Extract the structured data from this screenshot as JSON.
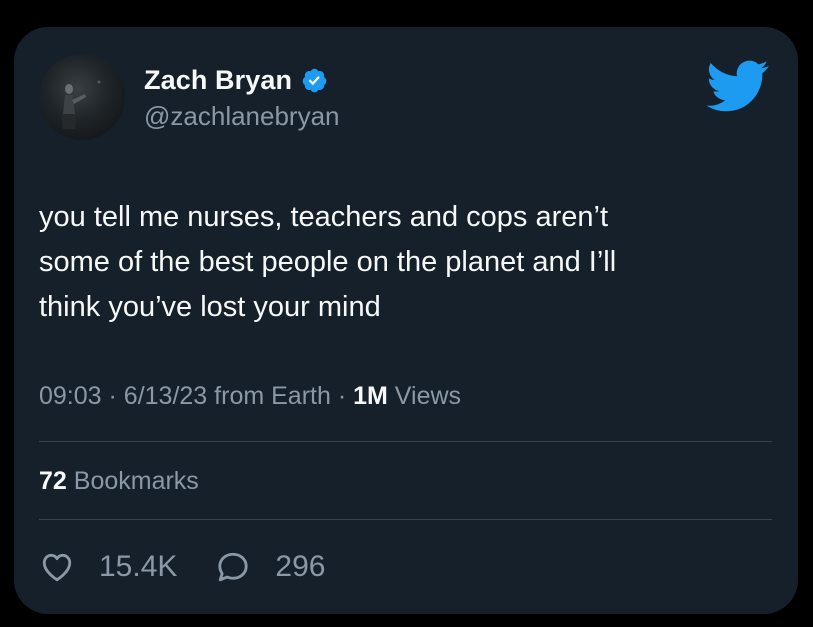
{
  "user": {
    "name": "Zach Bryan",
    "handle": "@zachlanebryan"
  },
  "icons": {
    "avatar": "profile-photo",
    "verified": "verified-badge-icon",
    "brand": "twitter-bird-icon",
    "like": "heart-icon",
    "reply": "speech-bubble-icon"
  },
  "tweet": {
    "lines": [
      "you tell me nurses, teachers and cops aren’t",
      "some of the best people on the planet and I’ll",
      "think you’ve lost your mind"
    ]
  },
  "meta": {
    "time": "09:03",
    "separator": "·",
    "date": "6/13/23",
    "source": "from Earth",
    "views_count": "1M",
    "views_label": "Views"
  },
  "stats": {
    "bookmarks_count": "72",
    "bookmarks_label": "Bookmarks",
    "likes": "15.4K",
    "replies": "296"
  },
  "colors": {
    "background": "#000000",
    "card": "#15202b",
    "primary_text": "#f7f9f9",
    "secondary_text": "#8b98a5",
    "brand_blue": "#1d9bf0",
    "divider": "#38444d"
  }
}
